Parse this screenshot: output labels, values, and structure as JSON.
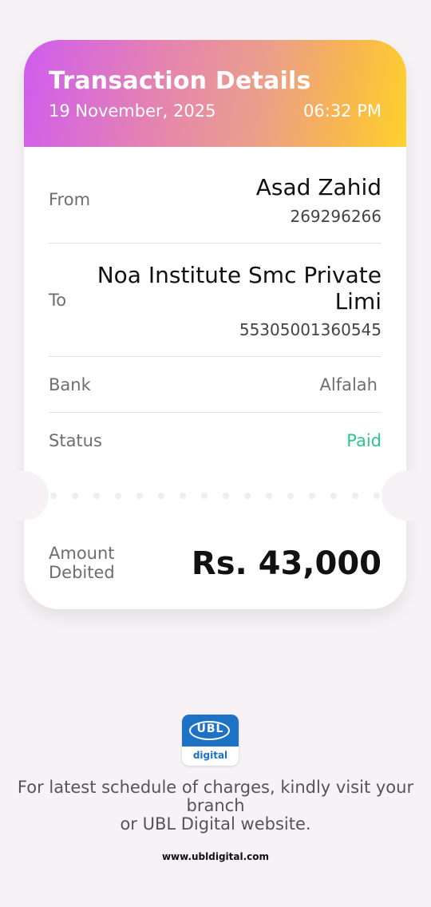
{
  "header": {
    "title": "Transaction Details",
    "date": "19 November, 2025",
    "time": "06:32 PM",
    "gradient_colors": [
      "#cf5cf0",
      "#e483b1",
      "#eb9f8a",
      "#fdd22c"
    ]
  },
  "from": {
    "label": "From",
    "name": "Asad Zahid",
    "account": "269296266"
  },
  "to": {
    "label": "To",
    "name": "Noa Institute Smc Private Limi",
    "account": "55305001360545"
  },
  "bank": {
    "label": "Bank",
    "value": "Alfalah"
  },
  "status": {
    "label": "Status",
    "value": "Paid",
    "color": "#2fc590"
  },
  "amount": {
    "label": "Amount Debited",
    "value": "Rs. 43,000"
  },
  "logo": {
    "brand": "UBL",
    "sub": "digital",
    "color": "#1d72c6"
  },
  "footer": {
    "note_line1": "For latest schedule of charges, kindly visit your",
    "note_line2": "branch",
    "note_line3": "or UBL Digital website.",
    "website": "www.ubldigital.com"
  }
}
